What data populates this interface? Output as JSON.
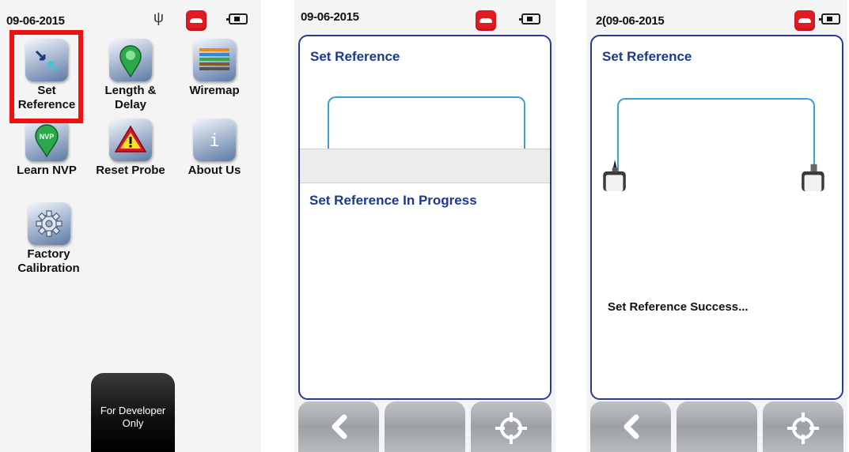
{
  "screen1": {
    "status": {
      "date": "09-06-2015",
      "icons": [
        "usb-icon",
        "phone-icon",
        "battery-icon"
      ]
    },
    "apps": [
      {
        "label": "Set Reference",
        "icon": "set-reference-icon"
      },
      {
        "label": "Length & Delay",
        "icon": "length-delay-icon"
      },
      {
        "label": "Wiremap",
        "icon": "wiremap-icon"
      },
      {
        "label": "Learn NVP",
        "icon": "learn-nvp-icon"
      },
      {
        "label": "Reset Probe",
        "icon": "reset-probe-icon"
      },
      {
        "label": "About Us",
        "icon": "about-us-icon"
      },
      {
        "label": "Factory Calibration",
        "icon": "factory-calibration-icon"
      }
    ],
    "nvp_badge": "NVP",
    "about_glyph": "i",
    "developer_button": {
      "line1": "For Developer",
      "line2": "Only"
    },
    "highlight_color": "#ee1111"
  },
  "screen2": {
    "status": {
      "date": "09-06-2015"
    },
    "panel_title": "Set Reference",
    "progress_text": "Set Reference In Progress",
    "nav": [
      "back-arrow-icon",
      "blank",
      "target-icon"
    ]
  },
  "screen3": {
    "status": {
      "date": "2(09-06-2015"
    },
    "panel_title": "Set Reference",
    "success_text": "Set Reference Success...",
    "nav": [
      "back-arrow-icon",
      "blank",
      "target-icon"
    ]
  },
  "colors": {
    "title_blue": "#1d3a8a",
    "panel_border": "#2a3b8f",
    "cable": "#3aa0d8",
    "phone_red": "#e21b23"
  }
}
